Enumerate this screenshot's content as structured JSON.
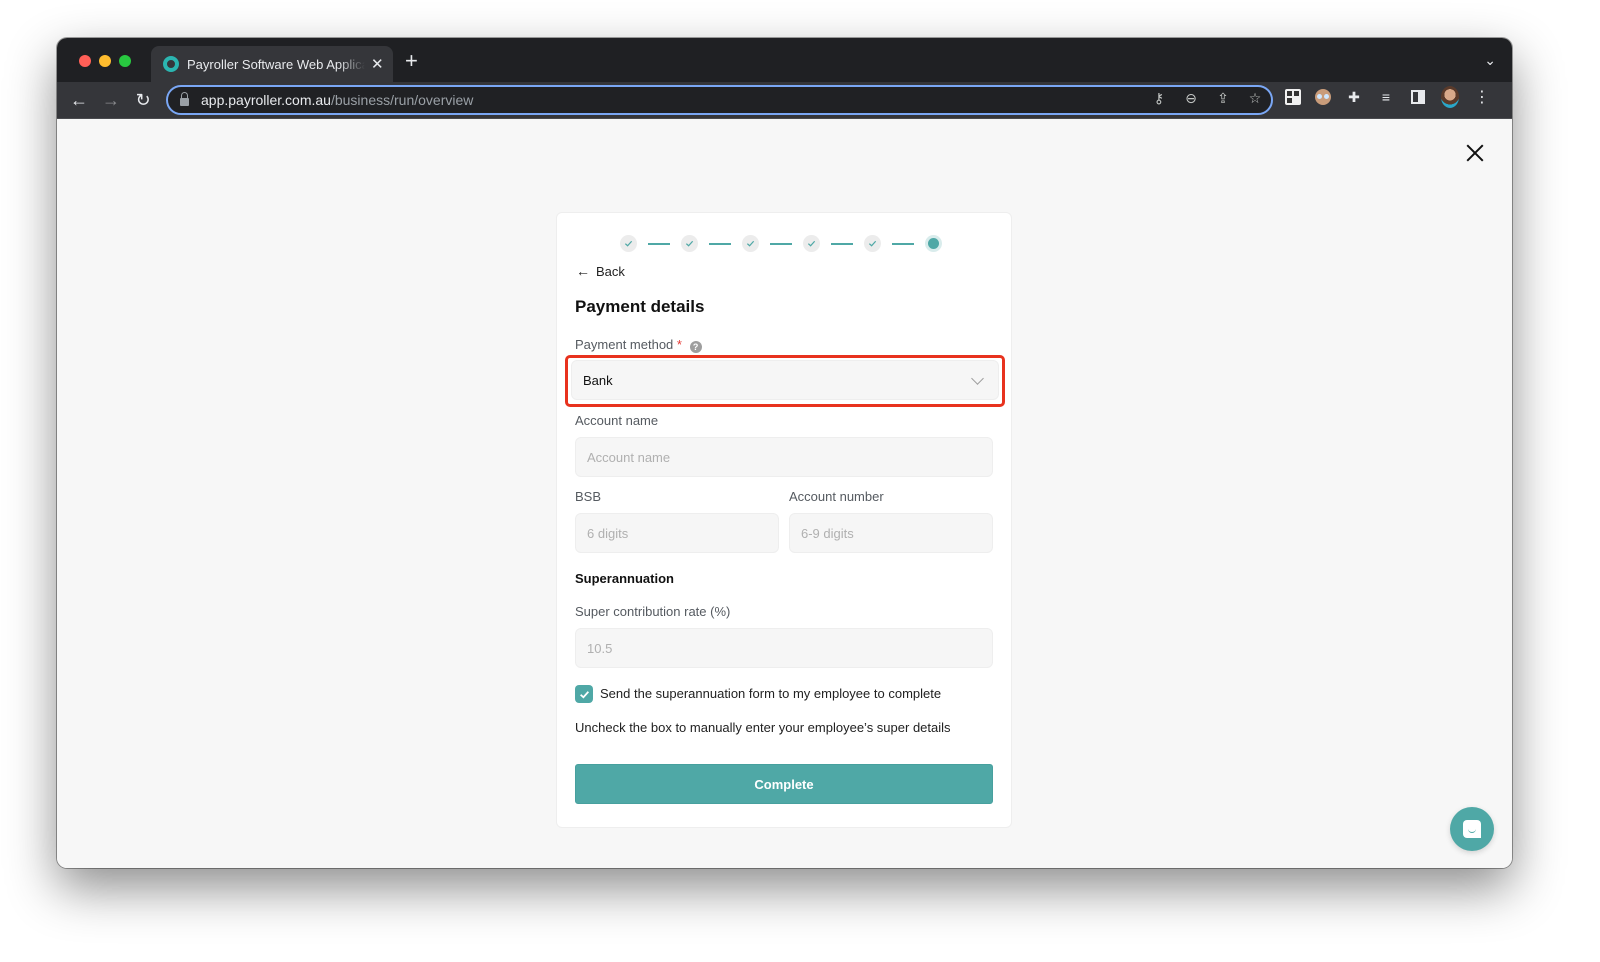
{
  "browser": {
    "tab": {
      "title": "Payroller Software Web Application",
      "favicon": "payroller-ring-icon"
    },
    "new_tab_label": "+",
    "address_bar": {
      "host": "app.payroller.com.au",
      "path": "/business/run/overview"
    },
    "omnibox_icons": [
      "key-icon",
      "zoom-out-icon",
      "share-icon",
      "bookmark-star-icon"
    ],
    "extension_icons": [
      "qr-code-extension-icon",
      "face-extension-icon",
      "puzzle-extensions-icon",
      "media-playlist-icon",
      "side-panel-icon",
      "profile-avatar"
    ],
    "glyphs": {
      "back": "←",
      "forward": "→",
      "reload": "↻",
      "tab_close": "✕",
      "key": "⚷",
      "zoom": "⊖",
      "share": "⇪",
      "star": "☆",
      "puzzle": "✚",
      "media": "≡",
      "kebab": "⋮",
      "dropdown": "⌄"
    }
  },
  "page": {
    "close_label": "Close",
    "stepper": {
      "total_steps": 6,
      "completed_steps": 5,
      "current_step": 6
    },
    "back_label": "Back",
    "back_arrow": "←",
    "title": "Payment details",
    "payment_method": {
      "label": "Payment method",
      "required_mark": "*",
      "help_glyph": "?",
      "value": "Bank"
    },
    "account_name": {
      "label": "Account name",
      "placeholder": "Account name"
    },
    "bsb": {
      "label": "BSB",
      "placeholder": "6 digits"
    },
    "account_number": {
      "label": "Account number",
      "placeholder": "6-9 digits"
    },
    "superannuation": {
      "heading": "Superannuation",
      "rate_label": "Super contribution rate (%)",
      "rate_placeholder": "10.5",
      "send_form_checkbox": {
        "label": "Send the superannuation form to my employee to complete",
        "checked": true
      },
      "hint": "Uncheck the box to manually enter your employee’s super details"
    },
    "complete_label": "Complete",
    "colors": {
      "accent": "#4fa8a6",
      "highlight": "#e8321e",
      "required": "#e53935"
    }
  }
}
